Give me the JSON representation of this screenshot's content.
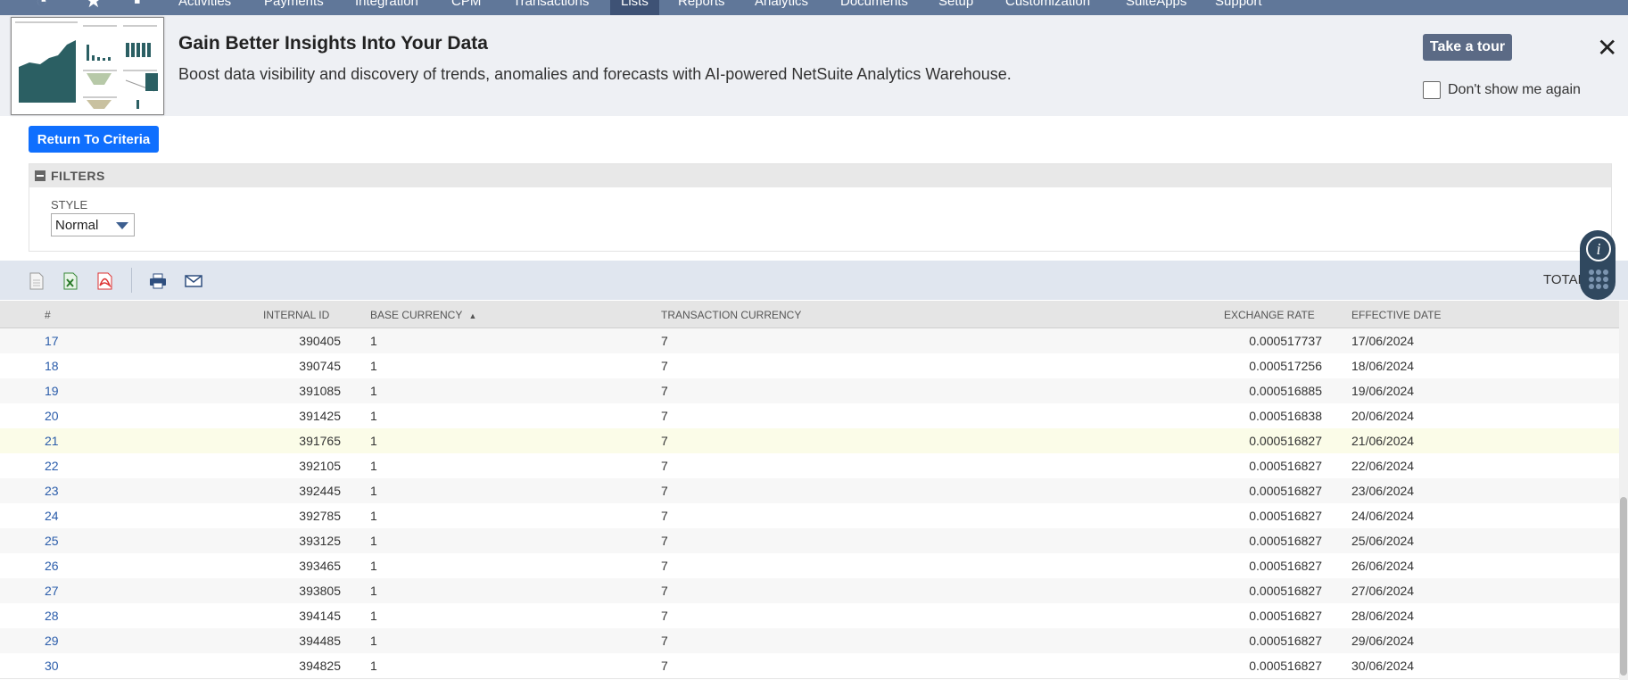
{
  "nav": {
    "items": [
      "Activities",
      "Payments",
      "Integration",
      "CPM",
      "Transactions",
      "Lists",
      "Reports",
      "Analytics",
      "Documents",
      "Setup",
      "Customization",
      "SuiteApps",
      "Support"
    ],
    "active": "Lists"
  },
  "banner": {
    "title": "Gain Better Insights Into Your Data",
    "text": "Boost data visibility and discovery of trends, anomalies and forecasts with AI-powered NetSuite Analytics Warehouse.",
    "tour_button": "Take a tour",
    "dont_show": "Don't show me again"
  },
  "return_button": "Return To Criteria",
  "filters": {
    "header": "FILTERS",
    "style_label": "STYLE",
    "style_value": "Normal"
  },
  "toolbar": {
    "total_label": "TOTAL"
  },
  "table": {
    "headers": {
      "num": "#",
      "internal_id": "INTERNAL ID",
      "base_currency": "BASE CURRENCY",
      "sort_indicator": "▲",
      "transaction_currency": "TRANSACTION CURRENCY",
      "exchange_rate": "EXCHANGE RATE",
      "effective_date": "EFFECTIVE DATE"
    },
    "rows": [
      {
        "num": "17",
        "id": "390405",
        "base": "1",
        "tc": "7",
        "rate": "0.000517737",
        "date": "17/06/2024"
      },
      {
        "num": "18",
        "id": "390745",
        "base": "1",
        "tc": "7",
        "rate": "0.000517256",
        "date": "18/06/2024"
      },
      {
        "num": "19",
        "id": "391085",
        "base": "1",
        "tc": "7",
        "rate": "0.000516885",
        "date": "19/06/2024"
      },
      {
        "num": "20",
        "id": "391425",
        "base": "1",
        "tc": "7",
        "rate": "0.000516838",
        "date": "20/06/2024"
      },
      {
        "num": "21",
        "id": "391765",
        "base": "1",
        "tc": "7",
        "rate": "0.000516827",
        "date": "21/06/2024"
      },
      {
        "num": "22",
        "id": "392105",
        "base": "1",
        "tc": "7",
        "rate": "0.000516827",
        "date": "22/06/2024"
      },
      {
        "num": "23",
        "id": "392445",
        "base": "1",
        "tc": "7",
        "rate": "0.000516827",
        "date": "23/06/2024"
      },
      {
        "num": "24",
        "id": "392785",
        "base": "1",
        "tc": "7",
        "rate": "0.000516827",
        "date": "24/06/2024"
      },
      {
        "num": "25",
        "id": "393125",
        "base": "1",
        "tc": "7",
        "rate": "0.000516827",
        "date": "25/06/2024"
      },
      {
        "num": "26",
        "id": "393465",
        "base": "1",
        "tc": "7",
        "rate": "0.000516827",
        "date": "26/06/2024"
      },
      {
        "num": "27",
        "id": "393805",
        "base": "1",
        "tc": "7",
        "rate": "0.000516827",
        "date": "27/06/2024"
      },
      {
        "num": "28",
        "id": "394145",
        "base": "1",
        "tc": "7",
        "rate": "0.000516827",
        "date": "28/06/2024"
      },
      {
        "num": "29",
        "id": "394485",
        "base": "1",
        "tc": "7",
        "rate": "0.000516827",
        "date": "29/06/2024"
      },
      {
        "num": "30",
        "id": "394825",
        "base": "1",
        "tc": "7",
        "rate": "0.000516827",
        "date": "30/06/2024"
      }
    ],
    "highlighted_row": "21"
  },
  "colors": {
    "nav_bg": "#607799",
    "primary_button": "#0f6ffe",
    "tour_button": "#5b6a85",
    "link": "#2a5caa",
    "highlight_row": "#fbfce8"
  }
}
